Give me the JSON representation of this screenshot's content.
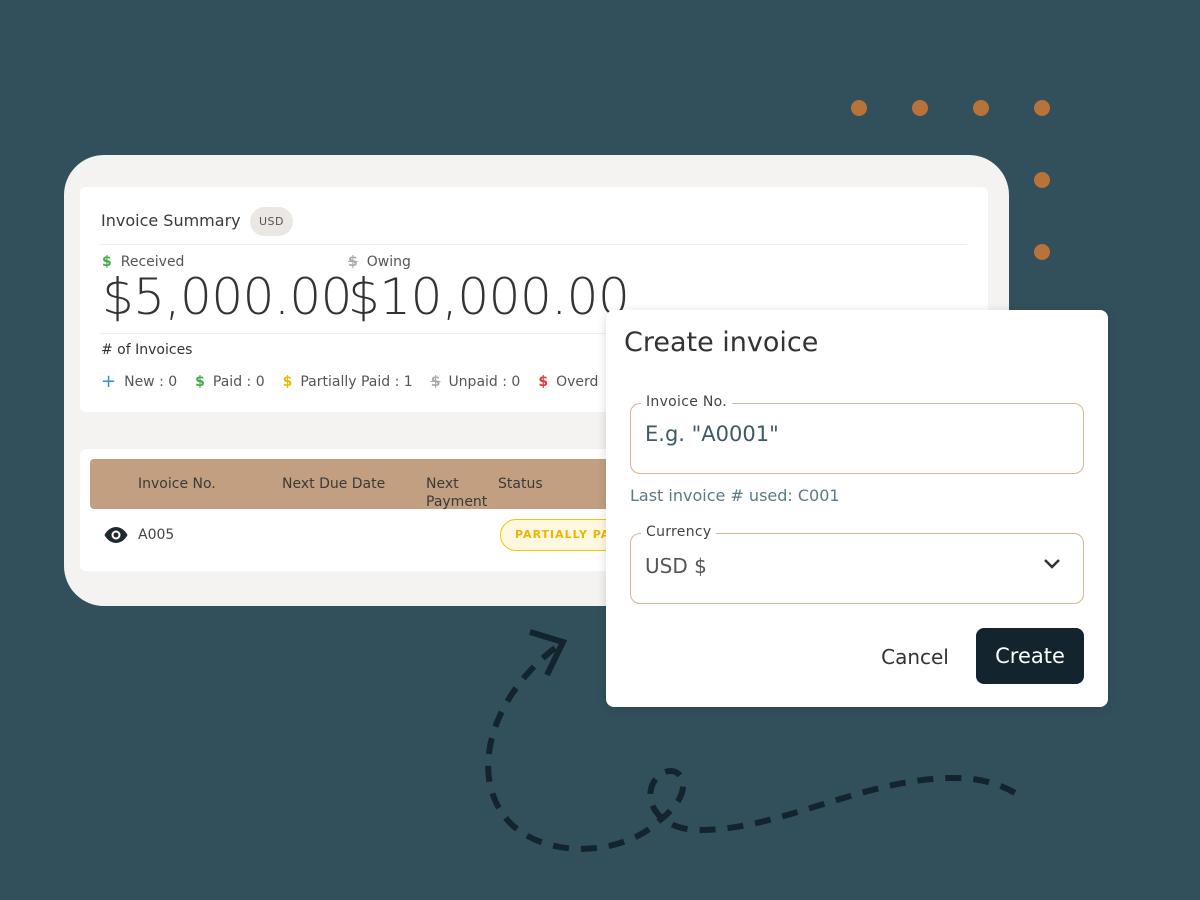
{
  "colors": {
    "background": "#32505c",
    "accent_dots": "#b8733a",
    "table_header": "#c19f80",
    "field_border": "#d8b696",
    "create_button": "#13242e",
    "received_icon": "#3fae49",
    "partially_paid": "#f5b800",
    "overdue": "#e53935",
    "new": "#2f8fdd"
  },
  "summary": {
    "title": "Invoice Summary",
    "currency_badge": "USD",
    "received": {
      "icon": "dollar-icon",
      "label": "Received",
      "amount": "$5,000.00"
    },
    "owing": {
      "icon": "dollar-off-icon",
      "label": "Owing",
      "amount": "$10,000.00"
    },
    "count_title": "# of Invoices",
    "counts": [
      {
        "icon": "plus-icon",
        "glyph": "+",
        "label": "New : 0"
      },
      {
        "icon": "dollar-icon",
        "glyph": "$",
        "label": "Paid : 0"
      },
      {
        "icon": "dollar-icon",
        "glyph": "$",
        "label": "Partially Paid : 1"
      },
      {
        "icon": "dollar-off-icon",
        "glyph": "$",
        "label": "Unpaid : 0"
      },
      {
        "icon": "dollar-icon",
        "glyph": "$",
        "label": "Overd"
      }
    ]
  },
  "table": {
    "columns": [
      "Invoice No.",
      "Next Due Date",
      "Next",
      "Payment",
      "Status"
    ],
    "rows": [
      {
        "invoice_no": "A005",
        "next_due_date": "",
        "next_payment": "",
        "status": "PARTIALLY PAI"
      }
    ]
  },
  "modal": {
    "title": "Create invoice",
    "invoice_field": {
      "label": "Invoice No.",
      "placeholder": "E.g. \"A0001\"",
      "value": ""
    },
    "hint": "Last invoice # used: C001",
    "currency_field": {
      "label": "Currency",
      "value": "USD $"
    },
    "cancel_label": "Cancel",
    "create_label": "Create"
  }
}
